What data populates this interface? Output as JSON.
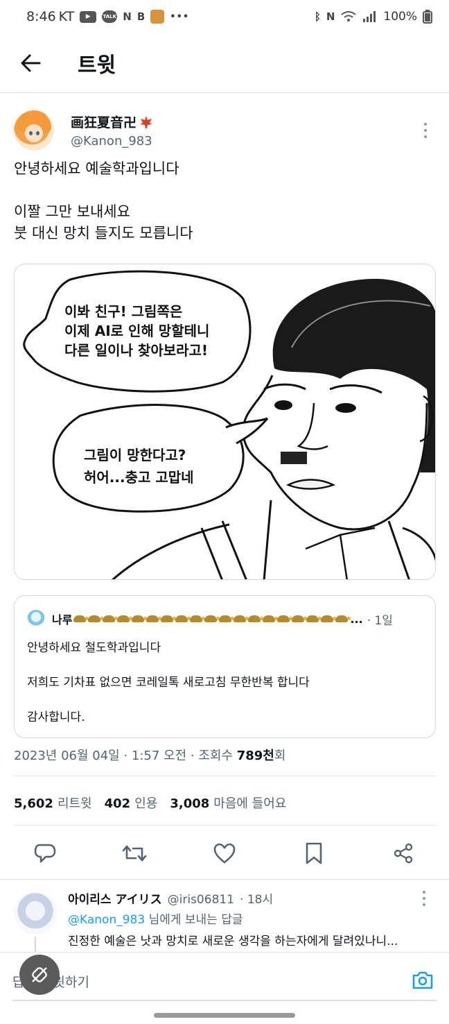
{
  "status_bar": {
    "time": "8:46",
    "carrier": "KT",
    "app_letters": [
      "N",
      "B"
    ],
    "battery": "100%",
    "talk_label": "TALK"
  },
  "header": {
    "title": "트윗"
  },
  "tweet": {
    "display_name": "画狂夏音卍",
    "handle": "@Kanon_983",
    "text_lines": [
      "안녕하세요 예술학과입니다",
      "이짤 그만 보내세요\n붓 대신 망치 들지도 모릅니다"
    ],
    "image": {
      "bubble1": [
        "이봐 친구! 그림쪽은",
        "이제 AI로 인해 망할테니",
        "다른 일이나 찾아보라고!"
      ],
      "bubble2": [
        "그림이 망한다고?",
        "허어...충고 고맙네"
      ]
    },
    "quote": {
      "name": "나루",
      "time": "· 1일",
      "lines": [
        "안녕하세요 철도학과입니다",
        "저희도 기차표 없으면 코레일톡 새로고침 무한반복 합니다",
        "감사합니다."
      ]
    },
    "meta": {
      "date": "2023년 06월 04일 · 1:57 오전 · 조회수 ",
      "views": "789천",
      "views_suffix": "회"
    },
    "stats": {
      "retweets": "5,602",
      "retweets_label": "리트윗",
      "quotes": "402",
      "quotes_label": "인용",
      "likes": "3,008",
      "likes_label": "마음에 들어요"
    }
  },
  "reply": {
    "name": "아이리스 アイリス",
    "handle": "@iris06811",
    "time": "· 18시",
    "reply_to_mention": "@Kanon_983",
    "reply_to_suffix": " 님에게 보내는 답글",
    "text": "진정한 예술은 낫과 망치로 새로운 생각을 하는자에게 달려있나니..."
  },
  "compose": {
    "placeholder": "답글 트윗하기"
  },
  "colors": {
    "accent": "#1d9bf0",
    "text": "#0f1419",
    "secondary": "#536471"
  },
  "icons": [
    "back-arrow-icon",
    "reply-icon",
    "retweet-icon",
    "like-icon",
    "bookmark-icon",
    "share-icon",
    "camera-icon",
    "more-icon"
  ]
}
